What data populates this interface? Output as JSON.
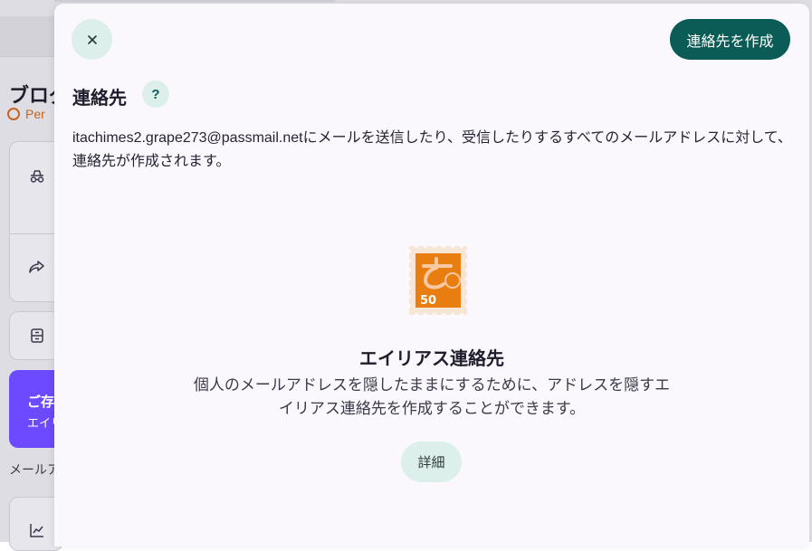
{
  "background": {
    "heading": "ブログ",
    "sub_label": "Per",
    "promo_title": "ご存",
    "promo_text": "エイリ",
    "section_label": "メールア",
    "icons": [
      "incognito-icon",
      "forward-icon",
      "archive-icon",
      "chart-icon"
    ]
  },
  "drawer": {
    "close_icon": "close-icon",
    "create_button": "連絡先を作成",
    "title": "連絡先",
    "help_label": "?",
    "description": "itachimes2.grape273@passmail.netにメールを送信したり、受信したりするすべてのメールアドレスに対して、連絡先が作成されます。",
    "empty_state": {
      "stamp_value": "50",
      "title": "エイリアス連絡先",
      "text": "個人のメールアドレスを隠したままにするために、アドレスを隠すエイリアス連絡先を作成することができます。",
      "details_button": "詳細"
    }
  },
  "colors": {
    "accent": "#0b5c56",
    "accent_soft": "#dcefea",
    "stamp_orange": "#e87d10",
    "promo_purple": "#6d4aff"
  }
}
